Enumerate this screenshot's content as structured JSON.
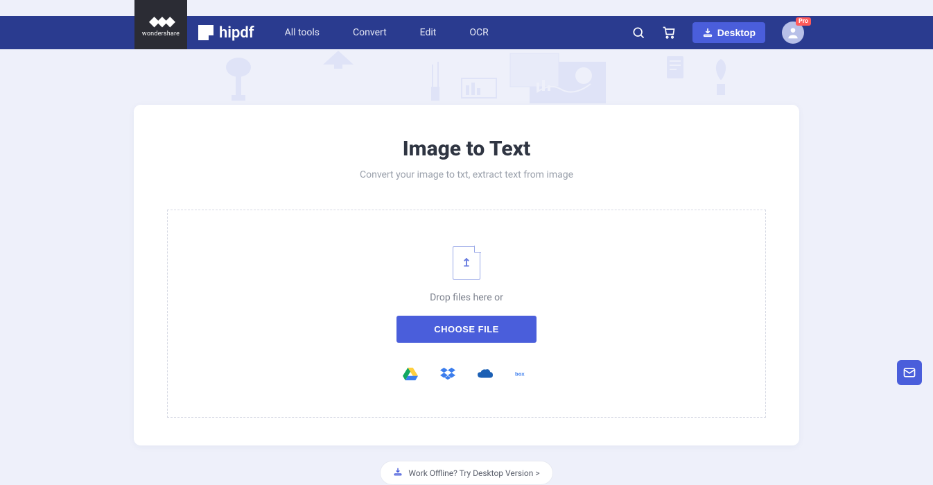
{
  "brand": {
    "parent": "wondershare",
    "product": "hipdf"
  },
  "nav": {
    "links": [
      "All tools",
      "Convert",
      "Edit",
      "OCR"
    ],
    "desktop_label": "Desktop",
    "pro_badge": "Pro"
  },
  "main": {
    "title": "Image to Text",
    "subtitle": "Convert your image to txt, extract text from image",
    "drop_text": "Drop files here or",
    "choose_label": "CHOOSE FILE",
    "cloud_providers": [
      "google-drive",
      "dropbox",
      "onedrive",
      "box"
    ]
  },
  "offline_cta": "Work Offline? Try Desktop Version >"
}
